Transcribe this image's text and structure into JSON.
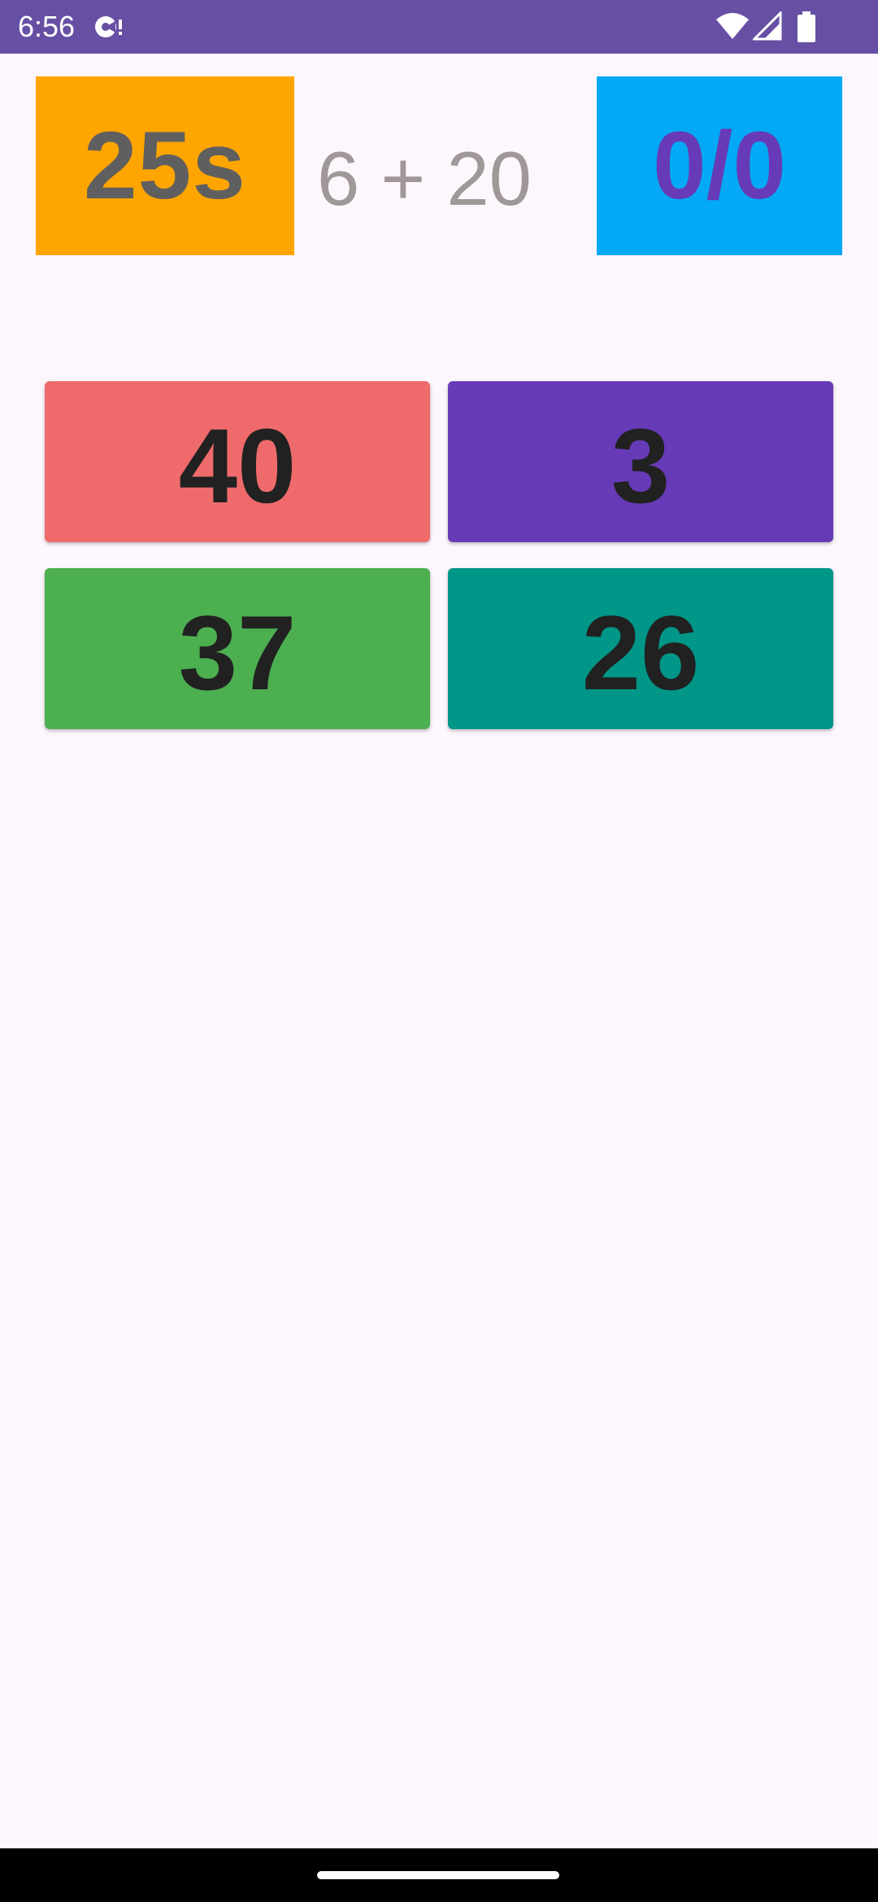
{
  "status_bar": {
    "time": "6:56",
    "icons": [
      "notification-icon",
      "wifi-icon",
      "signal-icon",
      "battery-icon"
    ],
    "background": "#6750A4"
  },
  "game": {
    "timer": "25s",
    "problem": "6 + 20",
    "score": "0/0",
    "colors": {
      "timer_bg": "#FFA500",
      "score_bg": "#03A9F4",
      "score_text": "#673AB7"
    }
  },
  "answers": [
    {
      "label": "40",
      "color": "#EF6B6B"
    },
    {
      "label": "3",
      "color": "#673AB7"
    },
    {
      "label": "37",
      "color": "#4CAF50"
    },
    {
      "label": "26",
      "color": "#009688"
    }
  ]
}
